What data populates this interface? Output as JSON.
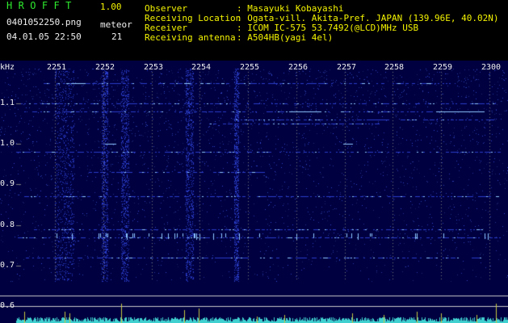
{
  "header": {
    "app_name": "HROFFT",
    "version": "1.00",
    "filename": "0401052250.png",
    "datetime": "04.01.05 22:50",
    "meteor_label": "meteor",
    "meteor_count": "21",
    "observer_label": "Observer",
    "observer_value": ": Masayuki Kobayashi",
    "location_label": "Receiving Location",
    "location_value": ": Ogata-vill. Akita-Pref. JAPAN (139.96E, 40.02N)",
    "receiver_label": "Receiver",
    "receiver_value": ": ICOM IC-575 53.7492(@LCD)MHz USB",
    "antenna_label": "Receiving antenna",
    "antenna_value": ": A504HB(yagi 4el)"
  },
  "spectrogram": {
    "unit_label": "kHz",
    "time_ticks": [
      "2251",
      "2252",
      "2253",
      "2254",
      "2255",
      "2256",
      "2257",
      "2258",
      "2259",
      "2300"
    ],
    "freq_ticks": [
      "1.1",
      "1.0",
      "0.9",
      "0.8",
      "0.7",
      "0.6"
    ],
    "freq_tick_values": [
      1.1,
      1.0,
      0.9,
      0.8,
      0.7,
      0.6
    ],
    "time_tick_minutes": [
      1,
      2,
      3,
      4,
      5,
      6,
      7,
      8,
      9,
      10
    ],
    "colors": {
      "background": "#000040",
      "noise": "#2a3cc8",
      "echo": "#8fc8ff",
      "grid": "#7a7a7a",
      "level_line": "#c8c8c8",
      "meter": "#c8c840",
      "meter_noise": "#40d0d0"
    }
  }
}
